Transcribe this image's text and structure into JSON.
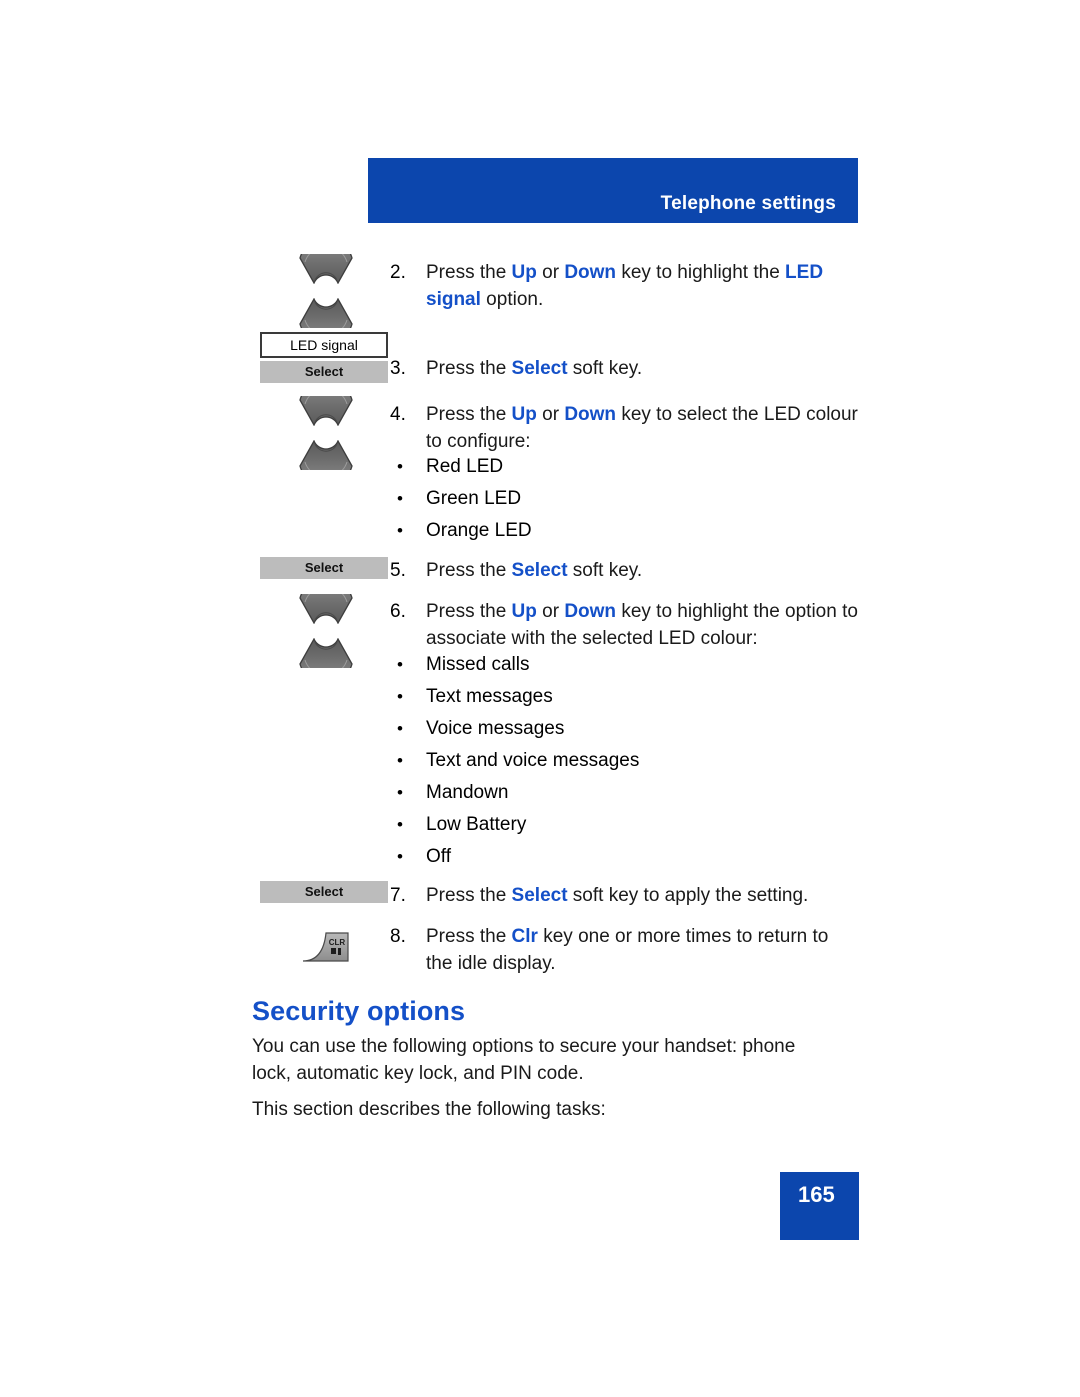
{
  "header": {
    "title": "Telephone settings"
  },
  "steps": [
    {
      "number": "2.",
      "parts": [
        {
          "t": "Press the ",
          "b": false
        },
        {
          "t": "Up",
          "b": true
        },
        {
          "t": " or ",
          "b": false
        },
        {
          "t": "Down",
          "b": true
        },
        {
          "t": " key to highlight the ",
          "b": false
        },
        {
          "t": "LED signal",
          "b": true
        },
        {
          "t": " option.",
          "b": false
        }
      ]
    },
    {
      "number": "3.",
      "parts": [
        {
          "t": "Press the ",
          "b": false
        },
        {
          "t": "Select",
          "b": true
        },
        {
          "t": " soft key.",
          "b": false
        }
      ]
    },
    {
      "number": "4.",
      "parts": [
        {
          "t": "Press the ",
          "b": false
        },
        {
          "t": "Up",
          "b": true
        },
        {
          "t": " or ",
          "b": false
        },
        {
          "t": "Down",
          "b": true
        },
        {
          "t": " key to select the LED colour to configure:",
          "b": false
        }
      ]
    },
    {
      "number": "5.",
      "parts": [
        {
          "t": "Press the ",
          "b": false
        },
        {
          "t": "Select",
          "b": true
        },
        {
          "t": " soft key.",
          "b": false
        }
      ]
    },
    {
      "number": "6.",
      "parts": [
        {
          "t": "Press the ",
          "b": false
        },
        {
          "t": "Up",
          "b": true
        },
        {
          "t": " or ",
          "b": false
        },
        {
          "t": "Down",
          "b": true
        },
        {
          "t": " key to highlight the option to associate with the selected LED colour:",
          "b": false
        }
      ]
    },
    {
      "number": "7.",
      "parts": [
        {
          "t": "Press the ",
          "b": false
        },
        {
          "t": "Select",
          "b": true
        },
        {
          "t": " soft key to apply the setting.",
          "b": false
        }
      ]
    },
    {
      "number": "8.",
      "parts": [
        {
          "t": "Press the ",
          "b": false
        },
        {
          "t": "Clr",
          "b": true
        },
        {
          "t": " key one or more times to return to the idle display.",
          "b": false
        }
      ]
    }
  ],
  "led_colour_bullets": [
    {
      "bullet": "•",
      "label": "Red LED"
    },
    {
      "bullet": "•",
      "label": "Green LED"
    },
    {
      "bullet": "•",
      "label": "Orange LED"
    }
  ],
  "led_option_bullets": [
    {
      "bullet": "•",
      "label": "Missed calls"
    },
    {
      "bullet": "•",
      "label": "Text messages"
    },
    {
      "bullet": "•",
      "label": "Voice messages"
    },
    {
      "bullet": "•",
      "label": "Text and voice messages"
    },
    {
      "bullet": "•",
      "label": "Mandown"
    },
    {
      "bullet": "•",
      "label": "Low Battery"
    },
    {
      "bullet": "•",
      "label": "Off"
    }
  ],
  "key_graphics": {
    "nav_up_icon": "up-nav-key-icon",
    "nav_down_icon": "down-nav-key-icon",
    "display_label": "LED signal",
    "softkey_label": "Select",
    "clr_key_label": "CLR"
  },
  "section": {
    "heading": "Security options",
    "paragraph_1": "You can use the following options to secure your handset: phone lock, automatic key lock, and PIN code.",
    "paragraph_2": "This section describes the following tasks:"
  },
  "footer": {
    "page_number": "165"
  },
  "colors": {
    "brand_blue": "#0c46ad",
    "keyword_blue": "#1450c8",
    "softkey_gray": "#bcbcbc"
  }
}
